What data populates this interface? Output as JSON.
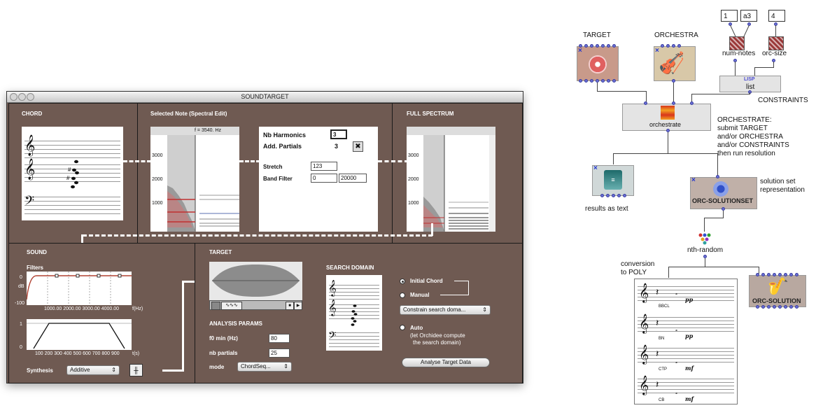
{
  "window": {
    "title": "SOUNDTARGET",
    "chord": {
      "title": "CHORD"
    },
    "selected_note": {
      "title": "Selected Note (Spectral Edit)",
      "freq_readout": "f = 3540. Hz",
      "axis_ticks": [
        "3000",
        "2000",
        "1000"
      ],
      "nb_harmonics_label": "Nb Harmonics",
      "nb_harmonics_value": "3",
      "add_partials_label": "Add. Partials",
      "add_partials_value": "3",
      "stretch_label": "Stretch",
      "stretch_value": "123",
      "band_filter_label": "Band Filter",
      "band_filter_low": "0",
      "band_filter_high": "20000"
    },
    "full_spectrum": {
      "title": "FULL SPECTRUM",
      "axis_ticks": [
        "3000",
        "2000",
        "1000"
      ]
    },
    "sound": {
      "title": "SOUND",
      "filters_label": "Filters",
      "db_label": "dB",
      "db_top": "0",
      "db_bottom": "-100",
      "freq_ticks": "1000.00 2000.00 3000.00 4000.00",
      "freq_unit": "f(Hz)",
      "env_top": "1",
      "env_bottom": "0",
      "time_ticks": "100 200 300 400 500 600 700 800 900",
      "time_unit": "t(s)",
      "synthesis_label": "Synthesis",
      "synthesis_value": "Additive"
    },
    "target": {
      "title": "TARGET",
      "analysis_title": "ANALYSIS PARAMS",
      "f0_label": "f0 min (Hz)",
      "f0_value": "80",
      "partials_label": "nb partials",
      "partials_value": "25",
      "mode_label": "mode",
      "mode_value": "ChordSeq..."
    },
    "search": {
      "title": "SEARCH DOMAIN",
      "initial_chord": "Initial Chord",
      "manual": "Manual",
      "constrain": "Constrain search doma...",
      "auto": "Auto",
      "auto_note1": "(let Orchidee compute",
      "auto_note2": "the search domain)",
      "analyse_button": "Analyse Target Data"
    }
  },
  "patch": {
    "num_values": [
      "1",
      "a3",
      "4"
    ],
    "num_notes": "num-notes",
    "orc_size": "orc-size",
    "lisp": "LISP",
    "list": "list",
    "constraints": "CONSTRAINTS",
    "target": "TARGET",
    "orchestra": "ORCHESTRA",
    "orchestrate": "orchestrate",
    "orchestrate_note": [
      "ORCHESTRATE:",
      "submit TARGET",
      "and/or ORCHESTRA",
      "and/or CONSTRAINTS",
      "then run resolution"
    ],
    "results_as_text": "results as text",
    "solutionset": "ORC-SOLUTIONSET",
    "solution_note": [
      "solution set",
      "representation"
    ],
    "nth_random": "nth-random",
    "conversion": [
      "conversion",
      "to POLY"
    ],
    "orc_solution": "ORC-SOLUTION",
    "instruments": [
      "BBCL",
      "BN",
      "CTP",
      "CB"
    ],
    "dynamics": [
      "pp",
      "pp",
      "mf",
      "mf"
    ]
  }
}
